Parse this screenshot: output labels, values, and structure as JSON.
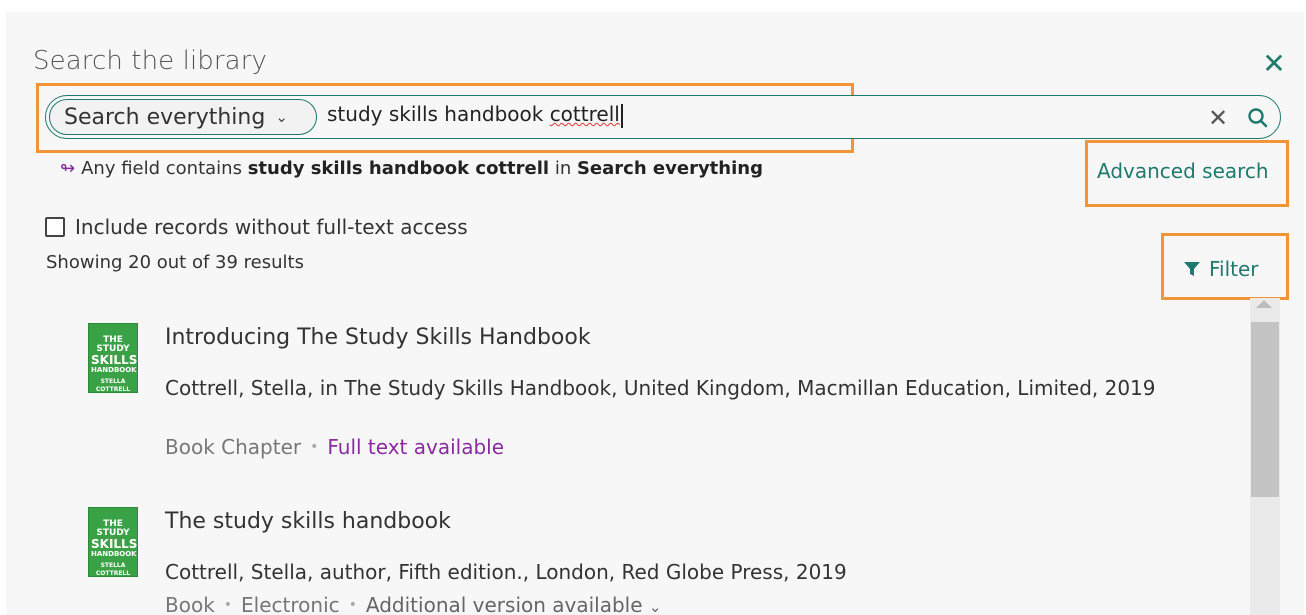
{
  "header": {
    "title": "Search the library",
    "close_icon": "close-icon"
  },
  "search": {
    "scope": "Search everything",
    "query_plain": "study skills handbook ",
    "query_flagged": "cottrell",
    "clear_icon": "clear-icon",
    "search_icon": "search-icon"
  },
  "hint": {
    "prefix": "Any field contains",
    "term": "study skills handbook cottrell",
    "middle": "in",
    "scope": "Search everything"
  },
  "advanced_search": "Advanced search",
  "fulltext_toggle": "Include records without full-text access",
  "results_count": "Showing 20 out of 39 results",
  "filter_label": "Filter",
  "results": [
    {
      "title": "Introducing The Study Skills Handbook",
      "meta": "Cottrell, Stella, in The Study Skills Handbook, United Kingdom, Macmillan Education, Limited, 2019",
      "type": "Book Chapter",
      "availability": "Full text available"
    },
    {
      "title": "The study skills handbook",
      "meta": "Cottrell, Stella, author, Fifth edition., London, Red Globe Press, 2019",
      "type": "Book",
      "format": "Electronic",
      "version": "Additional version available"
    }
  ],
  "colors": {
    "accent": "#1f7a6e",
    "highlight": "#f39536",
    "fulltext": "#8a2aa0"
  }
}
